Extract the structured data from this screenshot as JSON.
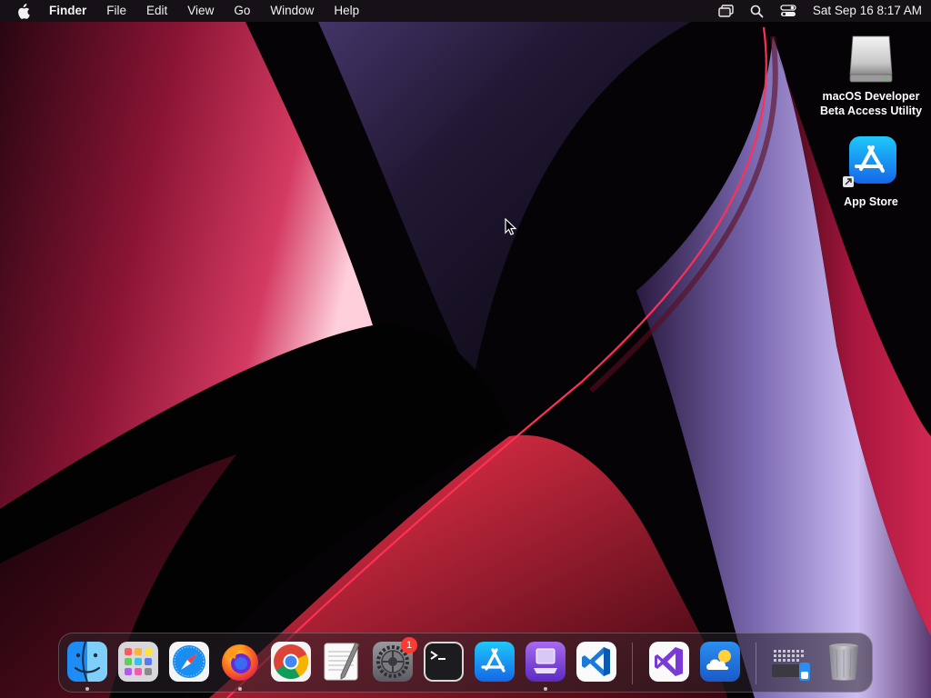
{
  "menubar": {
    "app_name": "Finder",
    "items": [
      "File",
      "Edit",
      "View",
      "Go",
      "Window",
      "Help"
    ],
    "clock": "Sat Sep 16  8:17 AM",
    "status_icons": [
      "screen-mirroring-icon",
      "spotlight-search-icon",
      "control-center-icon"
    ]
  },
  "desktop": {
    "icons": [
      {
        "label": "macOS Developer Beta Access Utility",
        "icon": "disk-image-icon"
      },
      {
        "label": "App Store",
        "icon": "app-store-alias-icon"
      }
    ]
  },
  "dock": {
    "apps": [
      {
        "name": "Finder",
        "icon": "finder-icon",
        "running": true
      },
      {
        "name": "Launchpad",
        "icon": "launchpad-icon",
        "running": false
      },
      {
        "name": "Safari",
        "icon": "safari-icon",
        "running": false
      },
      {
        "name": "Firefox",
        "icon": "firefox-icon",
        "running": true
      },
      {
        "name": "Google Chrome",
        "icon": "chrome-icon",
        "running": false
      },
      {
        "name": "TextEdit",
        "icon": "textedit-icon",
        "running": false
      },
      {
        "name": "System Settings",
        "icon": "system-settings-icon",
        "running": false,
        "badge": "1"
      },
      {
        "name": "Terminal",
        "icon": "terminal-icon",
        "running": false
      },
      {
        "name": "App Store",
        "icon": "app-store-icon",
        "running": false
      },
      {
        "name": "Simulator",
        "icon": "simulator-icon",
        "running": true
      },
      {
        "name": "Visual Studio Code",
        "icon": "vscode-icon",
        "running": false
      },
      {
        "name": "Visual Studio",
        "icon": "visual-studio-icon",
        "running": false
      },
      {
        "name": "Weather",
        "icon": "weather-icon",
        "running": false
      },
      {
        "name": "Downloads",
        "icon": "downloads-stack-icon",
        "running": false
      },
      {
        "name": "Trash",
        "icon": "trash-icon",
        "running": false
      }
    ]
  },
  "colors": {
    "wallpaper_red": "#b01840",
    "wallpaper_lavender": "#b8a8e8",
    "badge_red": "#ff3b30",
    "app_store_blue": "#1e8cf5"
  }
}
